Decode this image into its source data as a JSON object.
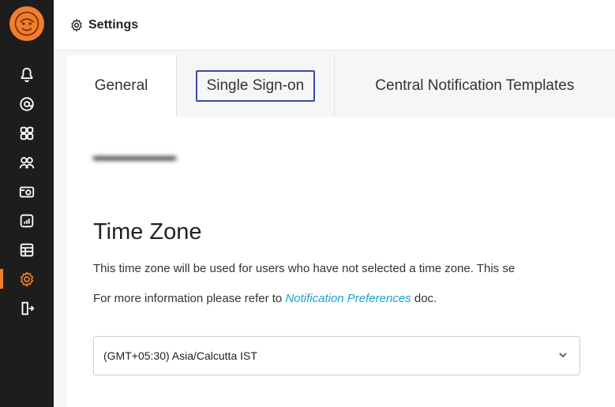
{
  "header": {
    "title": "Settings",
    "icon": "gear-icon"
  },
  "tabs": [
    {
      "label": "General"
    },
    {
      "label": "Single Sign-on"
    },
    {
      "label": "Central Notification Templates"
    }
  ],
  "time_zone": {
    "title": "Time Zone",
    "description": "This time zone will be used for users who have not selected a time zone. This se",
    "more_prefix": "For more information please refer to ",
    "more_link": "Notification Preferences",
    "more_suffix": " doc.",
    "selected": "(GMT+05:30) Asia/Calcutta IST"
  },
  "sidebar": {
    "items": [
      {
        "icon": "bell-icon"
      },
      {
        "icon": "at-sign-icon"
      },
      {
        "icon": "grid-icon"
      },
      {
        "icon": "users-icon"
      },
      {
        "icon": "camera-icon"
      },
      {
        "icon": "chart-icon"
      },
      {
        "icon": "table-icon"
      },
      {
        "icon": "gear-icon",
        "active": true
      },
      {
        "icon": "logout-icon"
      }
    ]
  },
  "colors": {
    "accent": "#f07e2d",
    "link": "#1aa3cf",
    "tab_outline": "#3b4aa0",
    "sidebar_bg": "#1d1d1d"
  }
}
